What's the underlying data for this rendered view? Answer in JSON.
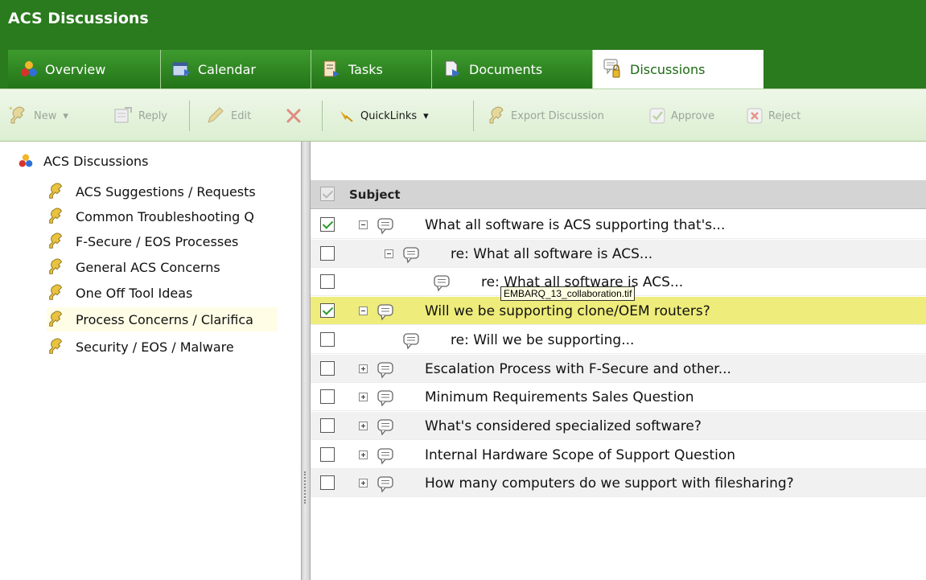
{
  "app": {
    "title": "ACS Discussions"
  },
  "tabs": [
    {
      "label": "Overview",
      "icon": "overview-icon",
      "active": false
    },
    {
      "label": "Calendar",
      "icon": "calendar-icon",
      "active": false
    },
    {
      "label": "Tasks",
      "icon": "tasks-icon",
      "active": false
    },
    {
      "label": "Documents",
      "icon": "documents-icon",
      "active": false
    },
    {
      "label": "Discussions",
      "icon": "discussions-icon",
      "active": true
    }
  ],
  "toolbar": {
    "new_label": "New",
    "reply_label": "Reply",
    "edit_label": "Edit",
    "quicklinks_label": "QuickLinks",
    "export_label": "Export Discussion",
    "approve_label": "Approve",
    "reject_label": "Reject"
  },
  "tree": {
    "root_label": "ACS Discussions",
    "items": [
      {
        "label": "ACS Suggestions / Requests"
      },
      {
        "label": "Common Troubleshooting Q"
      },
      {
        "label": "F-Secure / EOS Processes"
      },
      {
        "label": "General ACS Concerns"
      },
      {
        "label": "One Off Tool Ideas"
      },
      {
        "label": "Process Concerns / Clarifica"
      },
      {
        "label": "Security / EOS / Malware"
      }
    ]
  },
  "grid": {
    "column_subject": "Subject",
    "rows": [
      {
        "subject": "What all software is ACS supporting that's...",
        "checked": true,
        "level": 0,
        "expander": "minus"
      },
      {
        "subject": "re: What all software is ACS...",
        "checked": false,
        "level": 1,
        "expander": "minus"
      },
      {
        "subject": "re: What all software is ACS...",
        "checked": false,
        "level": 2,
        "expander": "none"
      },
      {
        "subject": "Will we be supporting clone/OEM routers?",
        "checked": true,
        "level": 0,
        "expander": "minus",
        "highlight": true
      },
      {
        "subject": "re: Will we be supporting...",
        "checked": false,
        "level": 1,
        "expander": "none"
      },
      {
        "subject": "Escalation Process with F-Secure and other...",
        "checked": false,
        "level": 0,
        "expander": "plus"
      },
      {
        "subject": "Minimum Requirements Sales Question",
        "checked": false,
        "level": 0,
        "expander": "plus"
      },
      {
        "subject": "What's considered specialized software?",
        "checked": false,
        "level": 0,
        "expander": "plus"
      },
      {
        "subject": "Internal Hardware Scope of Support Question",
        "checked": false,
        "level": 0,
        "expander": "plus"
      },
      {
        "subject": "How many computers do we support with filesharing?",
        "checked": false,
        "level": 0,
        "expander": "plus"
      }
    ]
  },
  "tooltip": {
    "text": "EMBARQ_13_collaboration.tif"
  },
  "colors": {
    "header_green": "#2a7a1e",
    "highlight_row": "#eeec7a",
    "toolbar_bg": "#e4f2dc"
  }
}
